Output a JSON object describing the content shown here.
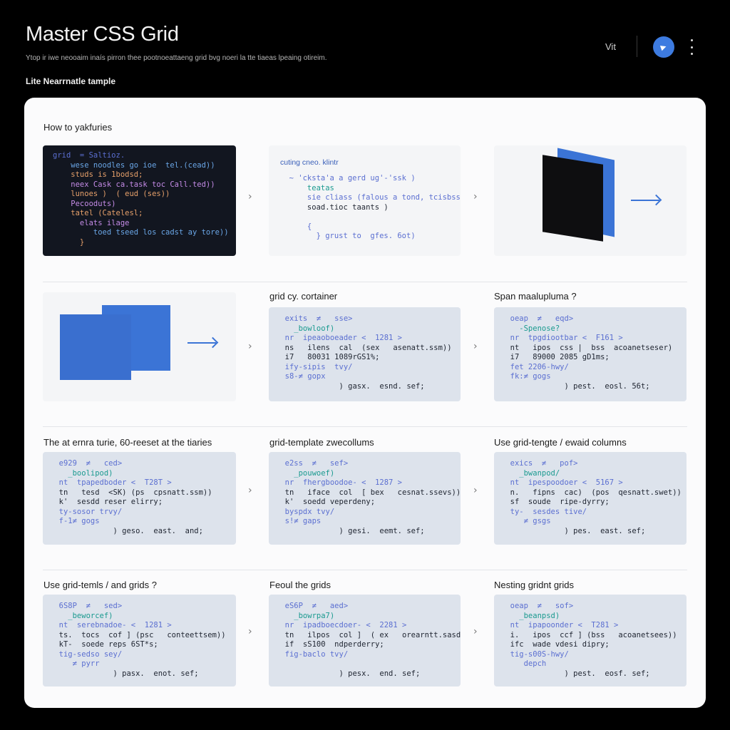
{
  "header": {
    "title": "Master CSS Grid",
    "subtitle": "Ytop ir iwe neooaim inaís pirron thee pootnoeattaeng grid bvg noeri la tte tiaeas lpeaing otireim.",
    "section_label": "Lite Nearrnatle tample",
    "lang": "Vit",
    "avatar_icon": "play-icon",
    "menu_icon": "kebab-icon"
  },
  "panel": {
    "title": "How to yakfuries"
  },
  "colors": {
    "accent": "#3b74d6",
    "panel_bg": "#fbfbfc",
    "card_light": "#dde3ec",
    "code_dark_bg": "#121620"
  },
  "row1": {
    "code_dark": [
      "grid  = Saltioz.",
      "    wese noodles go ioe  tel.(cead))",
      "    studs is 1bodsd;",
      "    neex Cask ca.task toc Call.ted))",
      "    lunoes )  ( eud (ses))",
      "    Pecooduts)",
      "    tatel (Catelesl;",
      "      elats ilage",
      "         toed tseed los cadst ay tore))",
      "      }"
    ],
    "white_head": "cuting cneo. klintr",
    "white_code": [
      "  ~ 'cksta'a a gerd ug'-'ssk )",
      "      teatas",
      "      sie cliass (falous a tond, tcisbssl)",
      "      soad.tioc taants )",
      "",
      "      {",
      "        } grust to  gfes. 6ot)"
    ]
  },
  "row2": {
    "heading_b": "grid cy. cortainer",
    "heading_c": "Span maalupluma ?",
    "code_b": [
      "  exits  ≠   sse>",
      "    _bowloof)",
      "  nr  ipeaoboeader <  1281 >",
      "  ns   ilens  cal  (sex   asenatt.ssm))",
      "  i7   80031 1089rGS1%;",
      "  ify-sipis  tvy/",
      "  s8-≠ gopx",
      "              ) gasx.  esnd. sef;"
    ],
    "code_c": [
      "  oeap  ≠   eqd>",
      "    -Spenose?",
      "  nr  tpgdiootbar <  F161 >",
      "  nt   ipos  css |  bss  acoanetseser)",
      "  i7   89000 2085 gD1ms;",
      "  fet 2206-hwy/",
      "  fk:≠ gogs",
      "              ) pest.  eosl. 56t;"
    ]
  },
  "row3": {
    "heading_a": "The at ernra turie, 60-reeset at the tiaries",
    "heading_b": "grid-template zwecollums",
    "heading_c": "Use grid-tengte / ewaid columns",
    "code_a": [
      "  e929  ≠   ced>",
      "    _boolipod)",
      "  nt  tpapedboder <  T28T >",
      "  tn   tesd  <SK) (ps  cpsnatt.ssm))",
      "  k'  sesdd reser elirry;",
      "  ty-sosor trvy/",
      "  f-1≠ gogs",
      "              ) geso.  east.  and;"
    ],
    "code_b": [
      "  e2ss  ≠   sef>",
      "    _pouwoef)",
      "  nr  fhergboodoe- <  1287 >",
      "  tn   iface  col  [ bex   cesnat.ssevs))",
      "  k'  soedd veperdeny;",
      "  byspdx tvy/",
      "  s!≠ gaps",
      "              ) gesi.  eemt. sef;"
    ],
    "code_c": [
      "  exics  ≠   pof>",
      "    _bwanpod/",
      "  nt  ipespoodoer <  5167 >",
      "  n.   fipns  cac)  (pos  qesnatt.swet))",
      "  sf  soude  ripe-dyrry;",
      "  ty-  sesdes tive/",
      "     ≠ gsgs",
      "              ) pes.  east. sef;"
    ]
  },
  "row4": {
    "heading_a": "Use grid-temls / and grids ?",
    "heading_b": "Feoul the grids",
    "heading_c": "Nesting gridnt grids",
    "code_a": [
      "  6S8P  ≠   sed>",
      "    _beworcef)",
      "  nt  serebnadoe- <  1281 >",
      "  ts.  tocs  cof ] (psc   conteettsem))",
      "  kT-  soede reps 6ST*s;",
      "  tig-sedso sey/",
      "     ≠ pyrr",
      "              ) pasx.  enot. sef;"
    ],
    "code_b": [
      "  eS6P  ≠   aed>",
      "    _bowrpa7)",
      "  nr  ipadboecdoer- <  2281 >",
      "  tn   ilpos  col ]  ( ex   orearntt.sasd))",
      "  if  sS100  ndperderry;",
      "  fig-baclo tvy/",
      "  ",
      "              ) pesx.  end. sef;"
    ],
    "code_c": [
      "  oeap  ≠   sof>",
      "    _beanpsd)",
      "  nt  ipapoonder <  T281 >",
      "  i.   ipos  ccf ] (bss   acoanetsees))",
      "  ifc  wade vdesi dipry;",
      "  tig-s00S-hwy/",
      "     depch",
      "              ) pest.  eosf. sef;"
    ]
  }
}
